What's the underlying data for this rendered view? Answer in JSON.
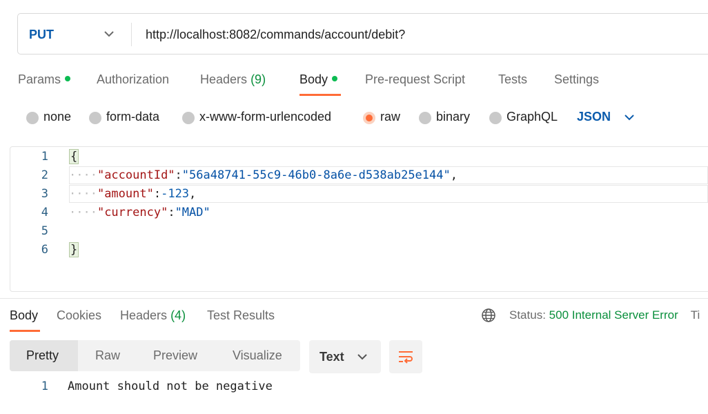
{
  "request": {
    "method": "PUT",
    "url": "http://localhost:8082/commands/account/debit?"
  },
  "tabs": [
    {
      "label": "Params",
      "dot": true
    },
    {
      "label": "Authorization"
    },
    {
      "label": "Headers",
      "count": "(9)"
    },
    {
      "label": "Body",
      "dot": true,
      "active": true
    },
    {
      "label": "Pre-request Script"
    },
    {
      "label": "Tests"
    },
    {
      "label": "Settings"
    }
  ],
  "body_types": {
    "options": [
      "none",
      "form-data",
      "x-www-form-urlencoded",
      "raw",
      "binary",
      "GraphQL"
    ],
    "selected": "raw",
    "format": "JSON"
  },
  "editor": {
    "line_numbers": [
      "1",
      "2",
      "3",
      "4",
      "5",
      "6"
    ],
    "open_brace": "{",
    "close_brace": "}",
    "indent": "····",
    "fields": [
      {
        "key": "\"accountId\"",
        "value": "\"56a48741-55c9-46b0-8a6e-d538ab25e144\"",
        "trail": ","
      },
      {
        "key": "\"amount\"",
        "value": "-123",
        "trail": ","
      },
      {
        "key": "\"currency\"",
        "value": "\"MAD\"",
        "trail": ""
      }
    ]
  },
  "response": {
    "tabs": [
      {
        "label": "Body",
        "active": true
      },
      {
        "label": "Cookies"
      },
      {
        "label": "Headers",
        "count": "(4)"
      },
      {
        "label": "Test Results"
      }
    ],
    "status_label": "Status:",
    "status_value": "500 Internal Server Error",
    "status_trunc": "Ti",
    "views": [
      "Pretty",
      "Raw",
      "Preview",
      "Visualize"
    ],
    "format": "Text",
    "line_number": "1",
    "body": "Amount should not be negative"
  },
  "colors": {
    "accent": "#ff6c37",
    "method": "#0b5cad",
    "success_dot": "#0cbb52",
    "status_error": "#0a8f3c"
  }
}
